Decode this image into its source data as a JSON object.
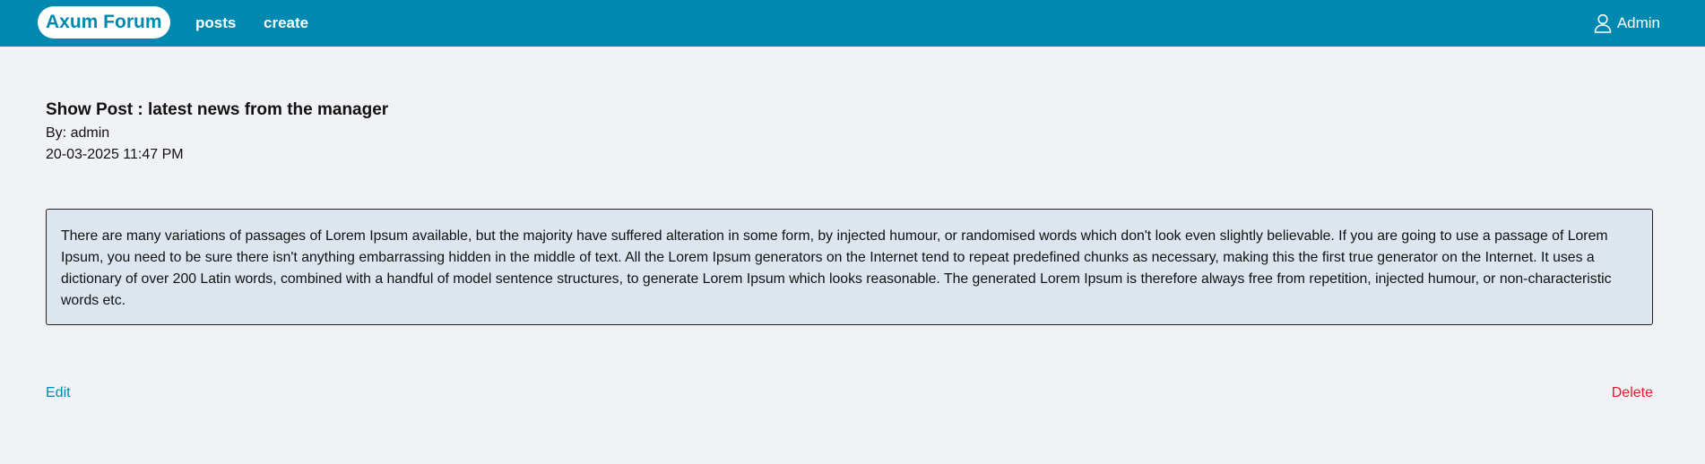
{
  "navbar": {
    "brand": "Axum Forum",
    "links": [
      {
        "label": "posts"
      },
      {
        "label": "create"
      }
    ],
    "user": {
      "icon": "user-icon",
      "label": "Admin"
    }
  },
  "post": {
    "title": "Show Post : latest news from the manager",
    "author": "By: admin",
    "date": "20-03-2025 11:47 PM",
    "body": "There are many variations of passages of Lorem Ipsum available, but the majority have suffered alteration in some form, by injected humour, or randomised words which don't look even slightly believable. If you are going to use a passage of Lorem Ipsum, you need to be sure there isn't anything embarrassing hidden in the middle of text. All the Lorem Ipsum generators on the Internet tend to repeat predefined chunks as necessary, making this the first true generator on the Internet. It uses a dictionary of over 200 Latin words, combined with a handful of model sentence structures, to generate Lorem Ipsum which looks reasonable. The generated Lorem Ipsum is therefore always free from repetition, injected humour, or non-characteristic words etc."
  },
  "actions": {
    "edit": "Edit",
    "delete": "Delete"
  },
  "colors": {
    "navbar": "#0089b0",
    "background": "#f0f2f5",
    "post_body_bg": "#dde5ef",
    "edit_link": "#0089b0",
    "delete_link": "#e8192c"
  }
}
